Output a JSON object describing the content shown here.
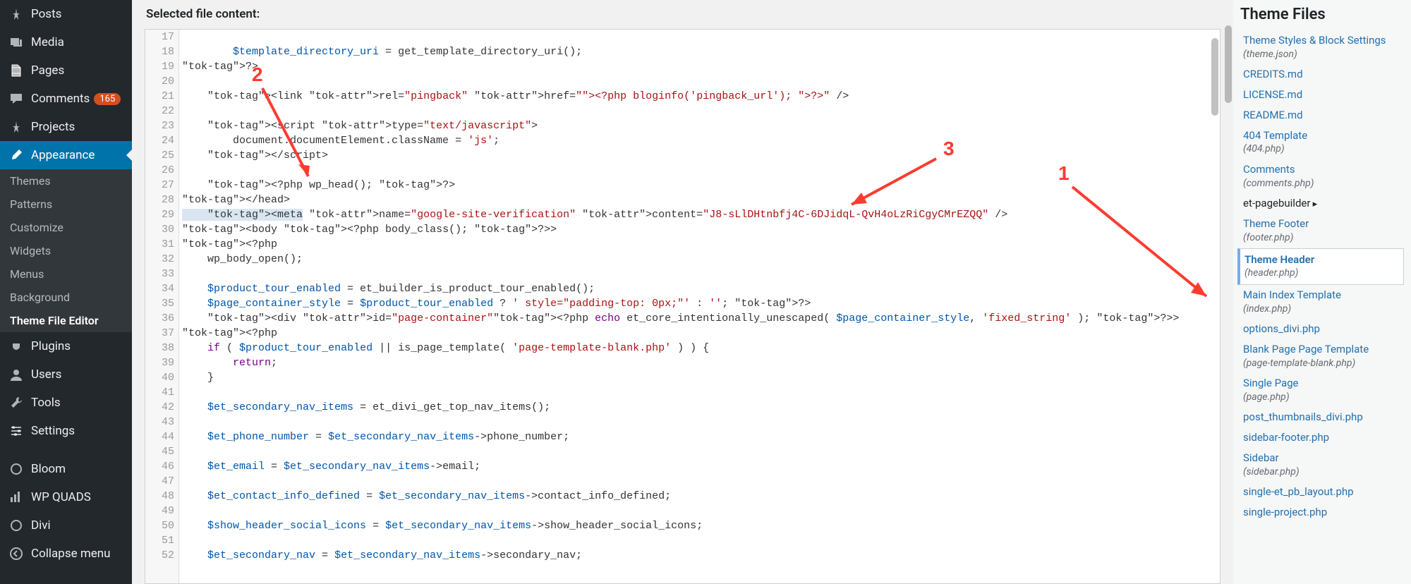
{
  "sidebar": {
    "items": [
      {
        "id": "posts",
        "label": "Posts",
        "icon": "pin"
      },
      {
        "id": "media",
        "label": "Media",
        "icon": "media"
      },
      {
        "id": "pages",
        "label": "Pages",
        "icon": "page"
      },
      {
        "id": "comments",
        "label": "Comments",
        "icon": "comment",
        "badge": "165"
      },
      {
        "id": "projects",
        "label": "Projects",
        "icon": "pin"
      },
      {
        "id": "appearance",
        "label": "Appearance",
        "icon": "brush",
        "active": true
      },
      {
        "id": "plugins",
        "label": "Plugins",
        "icon": "plug"
      },
      {
        "id": "users",
        "label": "Users",
        "icon": "user"
      },
      {
        "id": "tools",
        "label": "Tools",
        "icon": "wrench"
      },
      {
        "id": "settings",
        "label": "Settings",
        "icon": "sliders"
      },
      {
        "id": "bloom",
        "label": "Bloom",
        "icon": "circle"
      },
      {
        "id": "wpquads",
        "label": "WP QUADS",
        "icon": "bars"
      },
      {
        "id": "divi",
        "label": "Divi",
        "icon": "circle"
      },
      {
        "id": "collapse",
        "label": "Collapse menu",
        "icon": "collapse"
      }
    ],
    "appearance_sub": [
      {
        "id": "themes",
        "label": "Themes"
      },
      {
        "id": "patterns",
        "label": "Patterns"
      },
      {
        "id": "customize",
        "label": "Customize"
      },
      {
        "id": "widgets",
        "label": "Widgets"
      },
      {
        "id": "menus",
        "label": "Menus"
      },
      {
        "id": "background",
        "label": "Background"
      },
      {
        "id": "tfe",
        "label": "Theme File Editor",
        "bold": true
      }
    ]
  },
  "main": {
    "section_title": "Selected file content:"
  },
  "editor": {
    "first_line": 17,
    "lines": [
      "",
      "        $template_directory_uri = get_template_directory_uri();",
      "?>",
      "",
      "    <link rel=\"pingback\" href=\"<?php bloginfo('pingback_url'); ?>\" />",
      "",
      "    <script type=\"text/javascript\">",
      "        document.documentElement.className = 'js';",
      "    </script>",
      "",
      "    <?php wp_head(); ?>",
      "</head>",
      "    <meta name=\"google-site-verification\" content=\"J8-sLlDHtnbfj4C-6DJidqL-QvH4oLzRiCgyCMrEZQQ\" />",
      "<body <?php body_class(); ?>>",
      "<?php",
      "    wp_body_open();",
      "",
      "    $product_tour_enabled = et_builder_is_product_tour_enabled();",
      "    $page_container_style = $product_tour_enabled ? ' style=\"padding-top: 0px;\"' : ''; ?>",
      "    <div id=\"page-container\"<?php echo et_core_intentionally_unescaped( $page_container_style, 'fixed_string' ); ?>>",
      "<?php",
      "    if ( $product_tour_enabled || is_page_template( 'page-template-blank.php' ) ) {",
      "        return;",
      "    }",
      "",
      "    $et_secondary_nav_items = et_divi_get_top_nav_items();",
      "",
      "    $et_phone_number = $et_secondary_nav_items->phone_number;",
      "",
      "    $et_email = $et_secondary_nav_items->email;",
      "",
      "    $et_contact_info_defined = $et_secondary_nav_items->contact_info_defined;",
      "",
      "    $show_header_social_icons = $et_secondary_nav_items->show_header_social_icons;",
      "",
      "    $et_secondary_nav = $et_secondary_nav_items->secondary_nav;"
    ],
    "highlighted_line_index": 12
  },
  "files_panel": {
    "title": "Theme Files",
    "items": [
      {
        "label": "Theme Styles & Block Settings",
        "sub": "(theme.json)"
      },
      {
        "label": "CREDITS.md"
      },
      {
        "label": "LICENSE.md"
      },
      {
        "label": "README.md"
      },
      {
        "label": "404 Template",
        "sub": "(404.php)"
      },
      {
        "label": "Comments",
        "sub": "(comments.php)"
      },
      {
        "label": "et-pagebuilder",
        "folder": true
      },
      {
        "label": "Theme Footer",
        "sub": "(footer.php)"
      },
      {
        "label": "Theme Header",
        "sub": "(header.php)",
        "selected": true
      },
      {
        "label": "Main Index Template",
        "sub": "(index.php)"
      },
      {
        "label": "options_divi.php"
      },
      {
        "label": "Blank Page Page Template",
        "sub": "(page-template-blank.php)"
      },
      {
        "label": "Single Page",
        "sub": "(page.php)"
      },
      {
        "label": "post_thumbnails_divi.php"
      },
      {
        "label": "sidebar-footer.php"
      },
      {
        "label": "Sidebar",
        "sub": "(sidebar.php)"
      },
      {
        "label": "single-et_pb_layout.php"
      },
      {
        "label": "single-project.php"
      }
    ]
  },
  "annotations": {
    "a1": {
      "num": "1"
    },
    "a2": {
      "num": "2"
    },
    "a3": {
      "num": "3"
    }
  }
}
